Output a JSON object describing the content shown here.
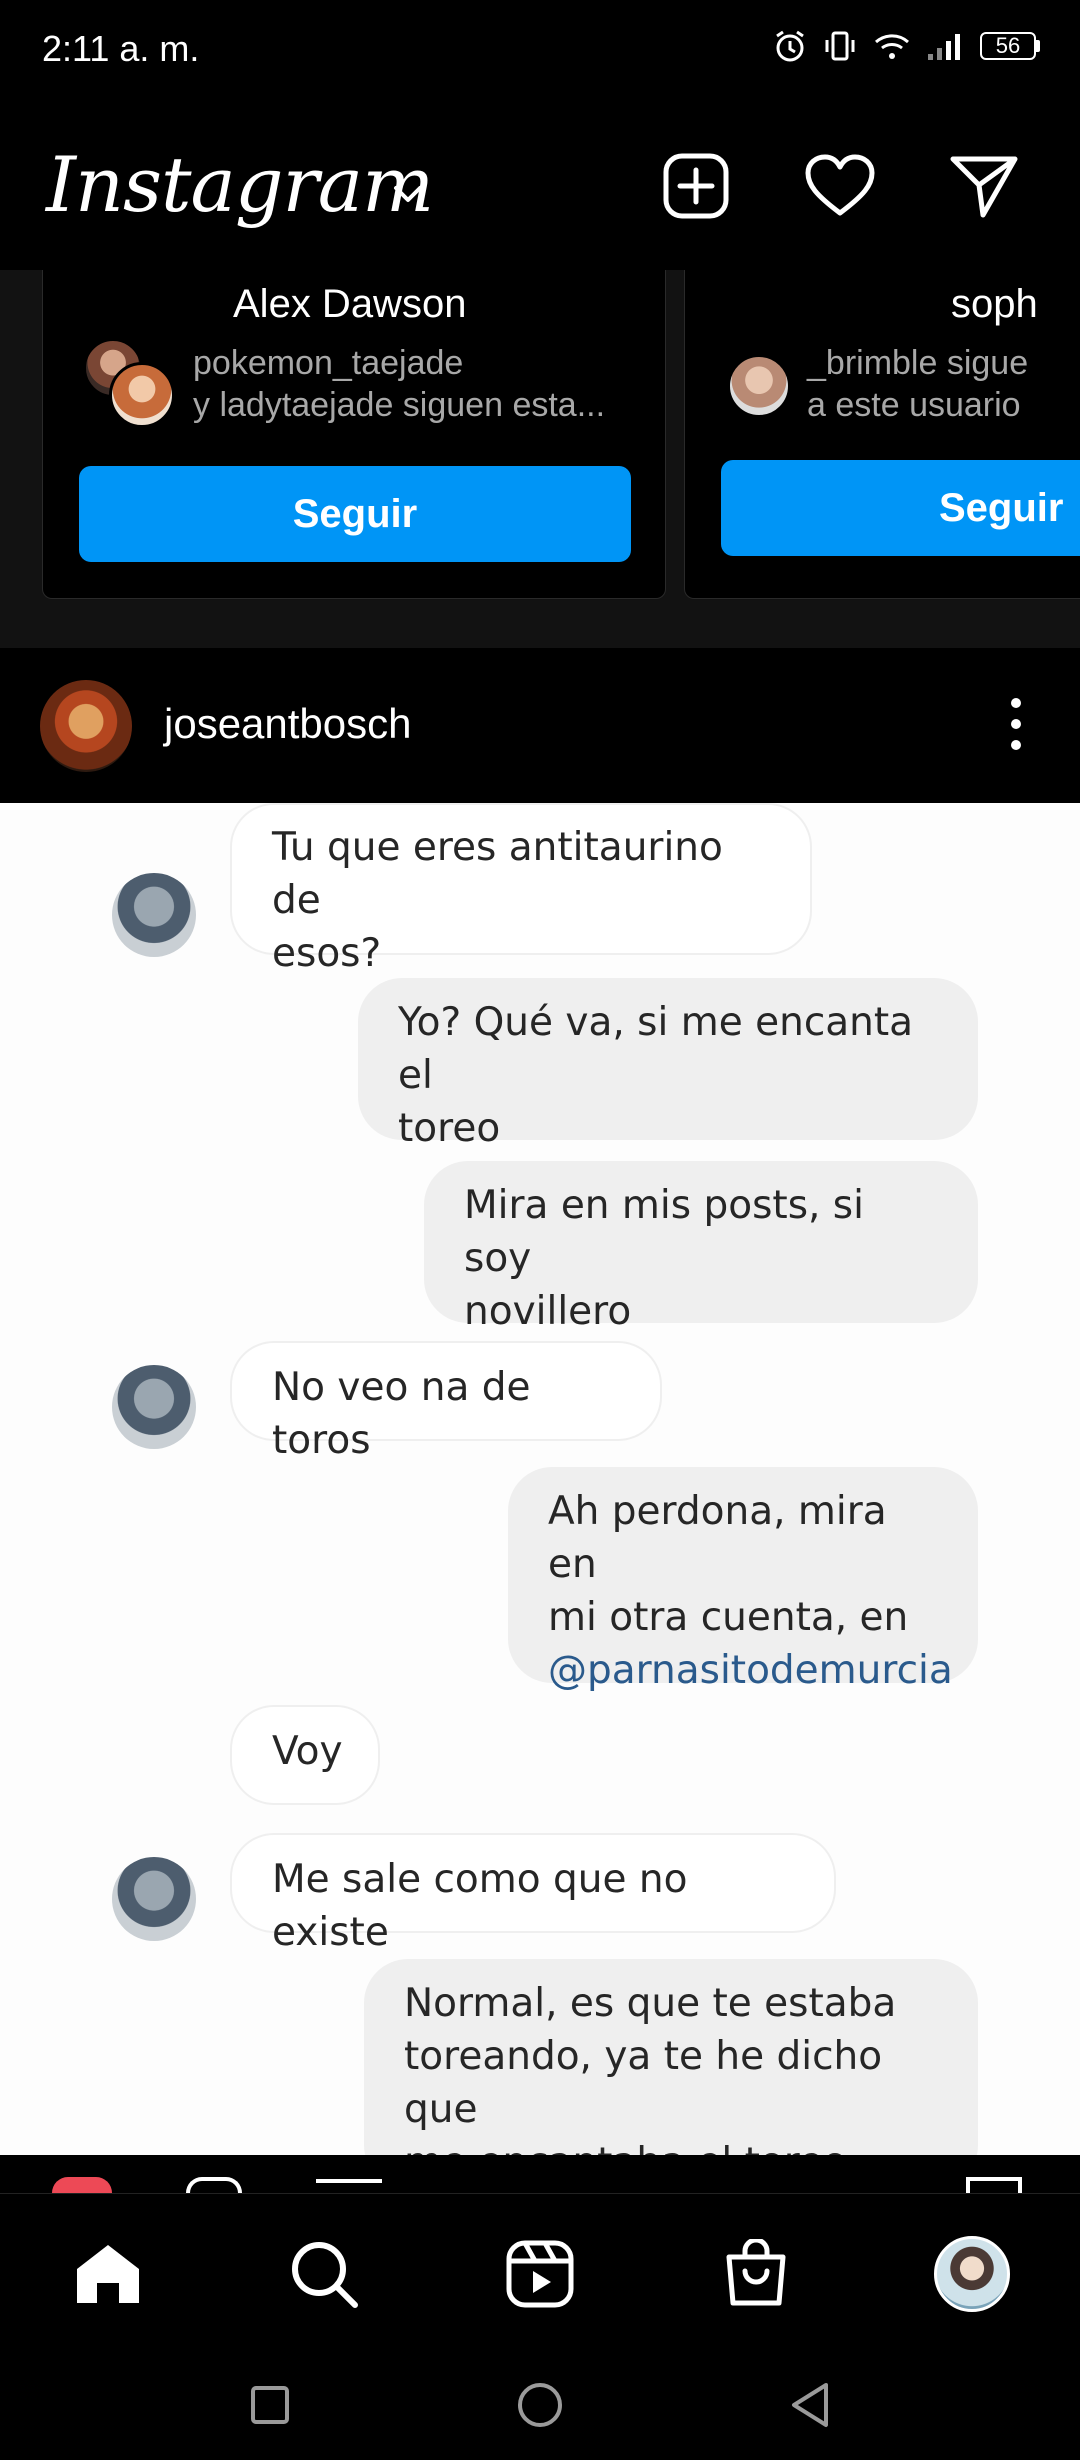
{
  "status_bar": {
    "time": "2:11 a. m.",
    "battery": "56"
  },
  "header": {
    "logo": "Instagram",
    "icons": [
      "new-post-icon",
      "heart-icon",
      "direct-message-icon"
    ]
  },
  "suggestions": [
    {
      "name": "Alex Dawson",
      "line1": "pokemon_taejade",
      "line2": "y ladytaejade siguen esta...",
      "button": "Seguir"
    },
    {
      "name": "soph",
      "line1": "_brimble sigue",
      "line2": "a este usuario",
      "button": "Seguir"
    }
  ],
  "post": {
    "username": "joseantbosch"
  },
  "chat": {
    "messages": [
      {
        "side": "in",
        "text": "Tu que eres antitaurino de\nesos?"
      },
      {
        "side": "out",
        "text": "Yo? Qué va, si me encanta el\ntoreo"
      },
      {
        "side": "out",
        "text": "Mira en mis posts, si soy\nnovillero"
      },
      {
        "side": "in",
        "text": "No veo na de toros"
      },
      {
        "side": "out",
        "text": "Ah perdona, mira en\nmi otra cuenta, en"
      },
      {
        "side": "out",
        "mention": "@parnasitodemurcia"
      },
      {
        "side": "in",
        "text": "Voy"
      },
      {
        "side": "in",
        "text": "Me sale como que no existe"
      },
      {
        "side": "out",
        "text": "Normal, es que te estaba\ntoreando, ya te he dicho que\nme encantaba el toreo"
      }
    ]
  },
  "bottom_nav": [
    "home-icon",
    "search-icon",
    "reels-icon",
    "shop-icon",
    "profile-avatar"
  ],
  "colors": {
    "background": "#000000",
    "follow_button": "#0095f6",
    "mention": "#2a5a8c"
  }
}
